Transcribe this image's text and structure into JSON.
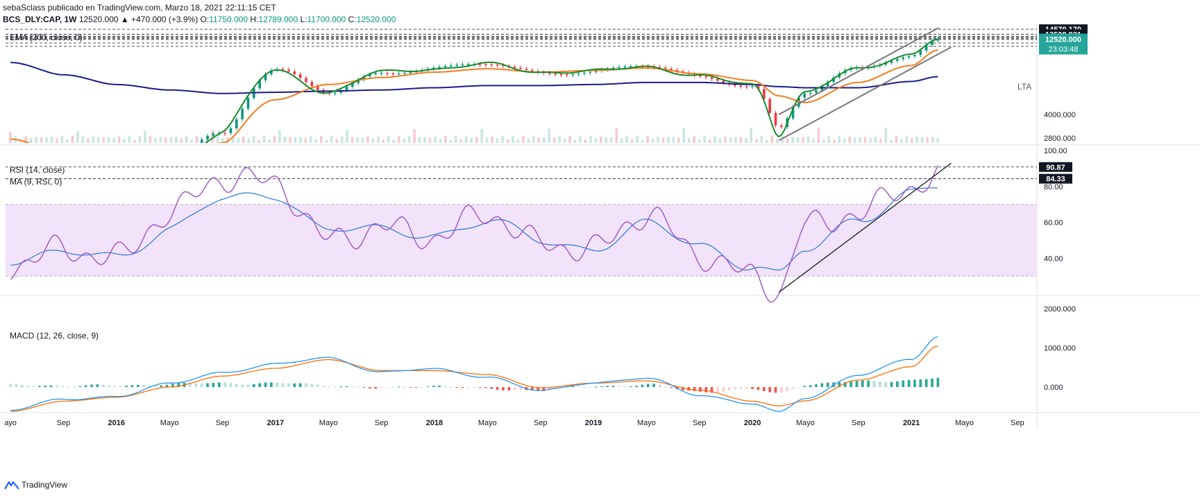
{
  "header": {
    "line1": "sebaSclass publicado en TradingView.com, Marzo 18, 2021 22:11:15 CET",
    "symbol": "BCS_DLY:CAP, 1W",
    "last": "12520.000",
    "change": "▲ +470.000 (+3.9%)",
    "o_label": "O:",
    "o_value": "11750.000",
    "h_label": "H:",
    "h_value": "12789.000",
    "l_label": "L:",
    "l_value": "11700.000",
    "c_label": "C:",
    "c_value": "12520.000"
  },
  "footer": {
    "brand": "TradingView",
    "brand_icon": "tradingview-logo-icon"
  },
  "colors": {
    "up": "#089981",
    "down": "#f23645",
    "ema200": "#1a1a8a",
    "ema_orange": "#f57c1f",
    "ema_green": "#178a2a",
    "rsi": "#a15cc4",
    "rsi_ma": "#2a78d6",
    "rsi_band": "#f2e3fb",
    "macd": "#2196f3",
    "signal": "#ff6d00",
    "channel": "#777777"
  },
  "chart_data": [
    {
      "type": "line",
      "name": "price",
      "title": "EMA (200, close, 0)",
      "scale": "log",
      "ylim": [
        2600,
        14900
      ],
      "y_ticks": [
        "4000.000",
        "2800.000"
      ],
      "level_lines": [
        "14570.170",
        "13508.931",
        "12484.621",
        "11823.371",
        "11228.875"
      ],
      "last_price": "12520.000",
      "countdown": "23:03:48",
      "annotation": "LTA",
      "x": [
        "2015-05",
        "2015-09",
        "2016-01",
        "2016-05",
        "2016-09",
        "2017-01",
        "2017-05",
        "2017-09",
        "2018-01",
        "2018-05",
        "2018-09",
        "2019-01",
        "2019-05",
        "2019-09",
        "2020-01",
        "2020-03",
        "2020-05",
        "2020-09",
        "2021-01",
        "2021-03"
      ],
      "series": [
        {
          "key": "close",
          "values": [
            2300,
            2000,
            1900,
            2050,
            3100,
            7700,
            5600,
            7600,
            8000,
            8600,
            7600,
            7700,
            8300,
            7100,
            6300,
            3100,
            5500,
            8000,
            9900,
            12520
          ]
        },
        {
          "key": "ema_orange",
          "values": [
            2750,
            2200,
            1900,
            1800,
            2600,
            5000,
            6300,
            7000,
            7600,
            8000,
            7600,
            7800,
            8100,
            7400,
            6700,
            5300,
            4800,
            6500,
            8400,
            10600
          ]
        },
        {
          "key": "ema200",
          "values": [
            8800,
            7300,
            6300,
            5800,
            5500,
            5600,
            5700,
            5800,
            6000,
            6200,
            6200,
            6300,
            6500,
            6500,
            6300,
            6100,
            6000,
            6000,
            6600,
            7100
          ]
        }
      ],
      "channel": [
        {
          "x": [
            "2020-03",
            "2021-04"
          ],
          "y": [
            2700,
            11100
          ]
        },
        {
          "x": [
            "2020-03",
            "2021-04"
          ],
          "y": [
            4000,
            16500
          ]
        }
      ]
    },
    {
      "type": "line",
      "name": "rsi",
      "title": "RSI (14, close)",
      "subtitle": "MA (9, RSI, 0)",
      "ylim": [
        20,
        102
      ],
      "y_ticks": [
        "100.00",
        "80.00",
        "60.00",
        "40.00"
      ],
      "band": [
        30,
        70
      ],
      "level_labels": [
        "90.87",
        "84.33"
      ],
      "x": [
        "2015-05",
        "2015-09",
        "2016-01",
        "2016-05",
        "2016-09",
        "2017-01",
        "2017-05",
        "2017-09",
        "2018-01",
        "2018-05",
        "2018-09",
        "2019-01",
        "2019-05",
        "2019-09",
        "2020-01",
        "2020-03",
        "2020-05",
        "2020-09",
        "2021-01",
        "2021-03"
      ],
      "series": [
        {
          "key": "rsi",
          "values": [
            36,
            45,
            40,
            65,
            85,
            82,
            50,
            57,
            52,
            65,
            48,
            45,
            65,
            42,
            30,
            22,
            58,
            65,
            80,
            86
          ]
        },
        {
          "key": "rsi_ma",
          "values": [
            40,
            42,
            41,
            57,
            72,
            76,
            56,
            55,
            54,
            60,
            50,
            46,
            58,
            48,
            36,
            30,
            44,
            63,
            76,
            79
          ]
        }
      ],
      "trendline": {
        "x": [
          "2020-03",
          "2021-04"
        ],
        "y": [
          21,
          93
        ]
      }
    },
    {
      "type": "bar",
      "name": "macd",
      "title": "MACD (12, 26, close, 9)",
      "ylim": [
        -600,
        2300
      ],
      "y_ticks": [
        "2000.000",
        "1000.000",
        "0.000"
      ],
      "x": [
        "2015-05",
        "2015-09",
        "2016-01",
        "2016-05",
        "2016-09",
        "2017-01",
        "2017-05",
        "2017-09",
        "2018-01",
        "2018-05",
        "2018-09",
        "2019-01",
        "2019-05",
        "2019-09",
        "2020-01",
        "2020-03",
        "2020-05",
        "2020-09",
        "2021-01",
        "2021-03"
      ],
      "series": [
        {
          "key": "macd",
          "values": [
            -580,
            -320,
            -230,
            80,
            380,
            580,
            750,
            380,
            460,
            260,
            -100,
            120,
            220,
            -200,
            -420,
            -650,
            -280,
            320,
            700,
            1280
          ]
        },
        {
          "key": "signal",
          "values": [
            -620,
            -360,
            -260,
            0,
            280,
            480,
            700,
            420,
            420,
            320,
            -20,
            100,
            160,
            -80,
            -360,
            -480,
            -350,
            180,
            520,
            1050
          ]
        },
        {
          "key": "hist",
          "values": [
            40,
            40,
            30,
            80,
            100,
            100,
            50,
            -40,
            40,
            -60,
            -80,
            20,
            60,
            -120,
            -60,
            -170,
            70,
            140,
            180,
            230
          ]
        }
      ]
    }
  ],
  "x_axis": {
    "labels": [
      {
        "text": "ayo",
        "date": "2015-05"
      },
      {
        "text": "Sep",
        "date": "2015-09"
      },
      {
        "text": "2016",
        "date": "2016-01",
        "bold": true
      },
      {
        "text": "Mayo",
        "date": "2016-05"
      },
      {
        "text": "Sep",
        "date": "2016-09"
      },
      {
        "text": "2017",
        "date": "2017-01",
        "bold": true
      },
      {
        "text": "Mayo",
        "date": "2017-05"
      },
      {
        "text": "Sep",
        "date": "2017-09"
      },
      {
        "text": "2018",
        "date": "2018-01",
        "bold": true
      },
      {
        "text": "Mayo",
        "date": "2018-05"
      },
      {
        "text": "Sep",
        "date": "2018-09"
      },
      {
        "text": "2019",
        "date": "2019-01",
        "bold": true
      },
      {
        "text": "Mayo",
        "date": "2019-05"
      },
      {
        "text": "Sep",
        "date": "2019-09"
      },
      {
        "text": "2020",
        "date": "2020-01",
        "bold": true
      },
      {
        "text": "Mayo",
        "date": "2020-05"
      },
      {
        "text": "Sep",
        "date": "2020-09"
      },
      {
        "text": "2021",
        "date": "2021-01",
        "bold": true
      },
      {
        "text": "Mayo",
        "date": "2021-05"
      },
      {
        "text": "Sep",
        "date": "2021-09"
      }
    ]
  }
}
